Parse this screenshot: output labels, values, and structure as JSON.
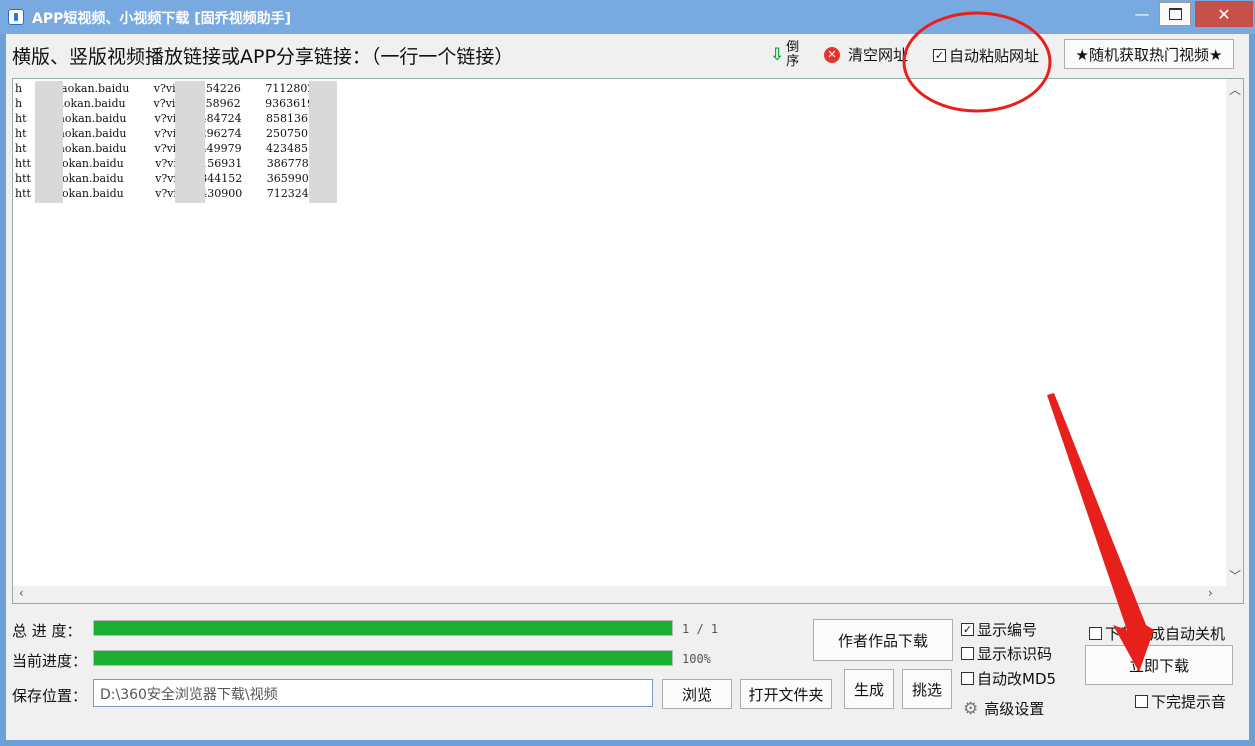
{
  "window": {
    "title": "APP短视频、小视频下载 [固乔视频助手]",
    "minimize": "—",
    "close": "✕"
  },
  "toolbar": {
    "instruction": "横版、竖版视频播放链接或APP分享链接：（一行一个链接）",
    "reverse_line1": "倒",
    "reverse_line2": "序",
    "clear_label": "清空网址",
    "auto_paste_label": "自动粘贴网址",
    "auto_paste_checked": true,
    "hot_video_label": "★随机获取热门视频★"
  },
  "links": [
    "h       //haokan.baidu       v?vid=5354226       7112802",
    "h       /haokan.baidu        v?vid=1258962       93636191",
    "ht      /haokan.baidu        v?vid=5484724       858136",
    "ht      /haokan.baidu        v?vid=7296274       2507501",
    "ht      /haokan.baidu        v?vid=1449979       4234855",
    "htt     haokan.baidu         v?vid=1156931       3867783",
    "htt     haokan.baidu         v?vid=1344152       3659904",
    "htt     haokan.baidu         v?vid=1430900       7123249"
  ],
  "progress": {
    "total_label": "总 进 度：",
    "total_value": "1 / 1",
    "total_fraction": 1.0,
    "current_label": "当前进度：",
    "current_value": "100%",
    "current_fraction": 1.0
  },
  "save": {
    "label": "保存位置：",
    "path": "D:\\360安全浏览器下载\\视频",
    "browse": "浏览",
    "open_folder": "打开文件夹"
  },
  "actions": {
    "author_download": "作者作品下载",
    "generate": "生成",
    "pick": "挑选",
    "download_now": "立即下载",
    "advanced": "高级设置"
  },
  "options": {
    "show_number": "显示编号",
    "show_number_checked": true,
    "show_id": "显示标识码",
    "show_id_checked": false,
    "auto_md5": "自动改MD5",
    "auto_md5_checked": false,
    "shutdown": "下载完成自动关机",
    "shutdown_checked": false,
    "sound": "下完提示音",
    "sound_checked": false
  },
  "colors": {
    "progress_fill": "#1cae33",
    "annotation": "#e8201b"
  }
}
